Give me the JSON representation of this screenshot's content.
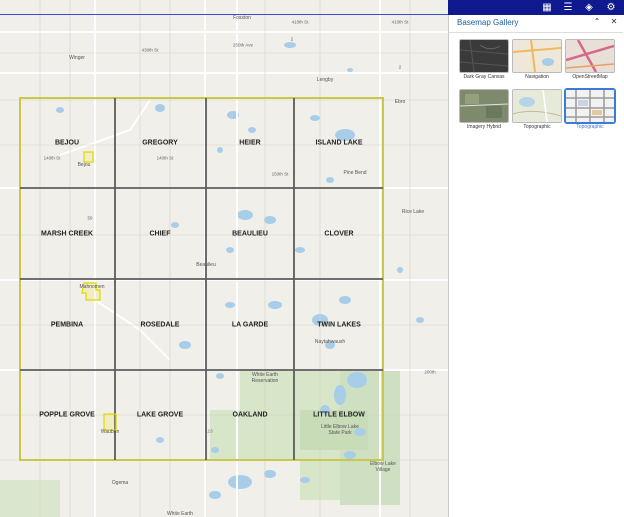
{
  "map": {
    "townships": [
      {
        "name": "BEJOU"
      },
      {
        "name": "GREGORY"
      },
      {
        "name": "HEIER"
      },
      {
        "name": "ISLAND LAKE"
      },
      {
        "name": "MARSH CREEK"
      },
      {
        "name": "CHIEF"
      },
      {
        "name": "BEAULIEU"
      },
      {
        "name": "CLOVER"
      },
      {
        "name": "PEMBINA"
      },
      {
        "name": "ROSEDALE"
      },
      {
        "name": "LA GARDE"
      },
      {
        "name": "TWIN LAKES"
      },
      {
        "name": "POPPLE GROVE"
      },
      {
        "name": "LAKE GROVE"
      },
      {
        "name": "OAKLAND"
      },
      {
        "name": "LITTLE ELBOW"
      }
    ],
    "places": {
      "fosston": "Fosston",
      "winger": "Winger",
      "lengby": "Lengby",
      "ebro": "Ebro",
      "bejou": "Bejou",
      "pine_bend": "Pine Bend",
      "rice_lake": "Rice Lake",
      "beaulieu": "Beaulieu",
      "mahnomen": "Mahnomen",
      "naytahwaush": "Naytahwaush",
      "white_earth": "White Earth Reservation",
      "little_elbow_park": "Little Elbow Lake State Park",
      "waubun": "Waubun",
      "elbow_lake": "Elbow Lake Village",
      "ogema": "Ogema",
      "white_earth_town": "White Earth"
    },
    "roads": {
      "r410_a": "410th St",
      "r410_b": "410th St",
      "r430": "430th St",
      "r140": "140th St",
      "r140_b": "140th St",
      "r150": "150th St",
      "r2": "2",
      "r2b": "2",
      "r59": "59",
      "r113": "113",
      "r200": "200th",
      "r250": "250th Ave"
    },
    "colors": {
      "boundary": "#c9c84a",
      "grid": "#5c5c5c",
      "water": "#a8cde8",
      "land": "#f1efe9",
      "park": "#d2e2c4"
    }
  },
  "toolbar": {
    "icons": [
      "basemap-gallery-icon",
      "legend-icon",
      "layers-icon",
      "tools-icon"
    ]
  },
  "panel": {
    "title": "Basemap Gallery",
    "collapse_symbol": "⌃",
    "close_symbol": "✕",
    "basemaps": [
      {
        "label": "Dark Gray Canvas",
        "selected": false
      },
      {
        "label": "Navigation",
        "selected": false
      },
      {
        "label": "OpenStreetMap",
        "selected": false
      },
      {
        "label": "Imagery Hybrid",
        "selected": false
      },
      {
        "label": "Topographic",
        "selected": false
      },
      {
        "label": "Topographic",
        "selected": true
      }
    ]
  }
}
